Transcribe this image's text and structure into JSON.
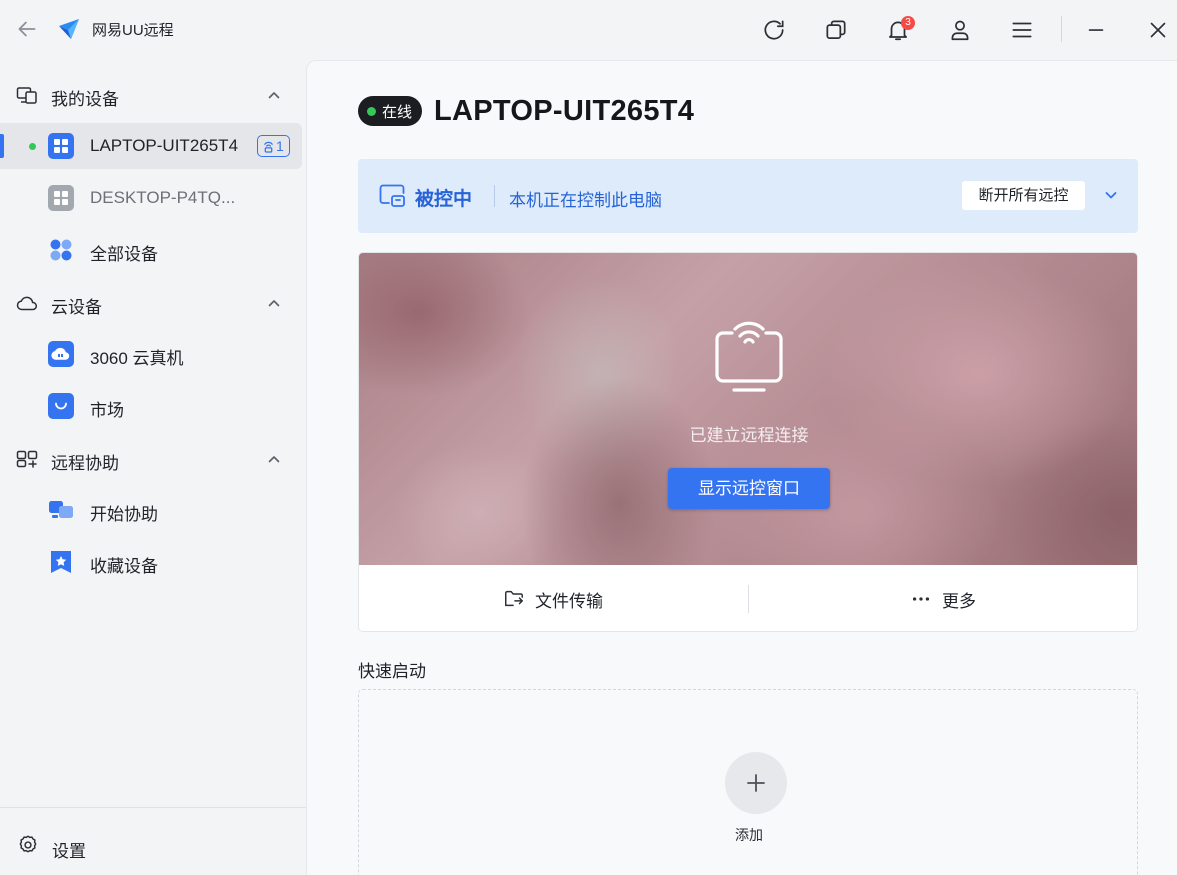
{
  "app": {
    "title": "网易UU远程",
    "notification_count": "3"
  },
  "sidebar": {
    "sections": {
      "my_devices": {
        "label": "我的设备"
      },
      "cloud": {
        "label": "云设备"
      },
      "assist": {
        "label": "远程协助"
      }
    },
    "items": {
      "laptop": {
        "label": "LAPTOP-UIT265T4",
        "tag": "1",
        "status": "online"
      },
      "desktop": {
        "label": "DESKTOP-P4TQ..."
      },
      "all_devices": {
        "label": "全部设备"
      },
      "cloud_pc": {
        "label": "3060 云真机"
      },
      "market": {
        "label": "市场"
      },
      "start_assist": {
        "label": "开始协助"
      },
      "favorites": {
        "label": "收藏设备"
      }
    },
    "settings_label": "设置"
  },
  "device": {
    "status": "在线",
    "name": "LAPTOP-UIT265T4"
  },
  "banner": {
    "title": "被控中",
    "description": "本机正在控制此电脑",
    "disconnect_label": "断开所有远控"
  },
  "preview": {
    "status_text": "已建立远程连接",
    "show_window_label": "显示远控窗口"
  },
  "actions": {
    "file_transfer": "文件传输",
    "more": "更多"
  },
  "quick_launch": {
    "title": "快速启动",
    "add_label": "添加"
  },
  "colors": {
    "accent": "#3574f0",
    "online": "#34c759",
    "badge": "#f54a45",
    "banner_bg": "#ddebfb"
  }
}
